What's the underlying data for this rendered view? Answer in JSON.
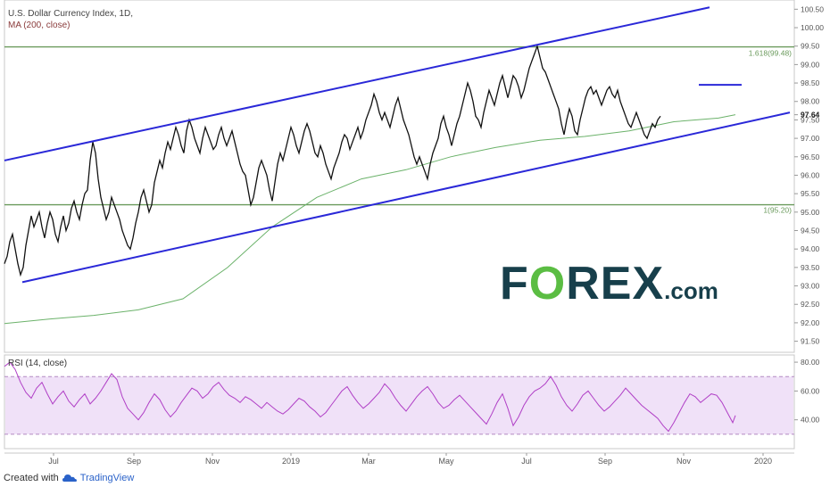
{
  "chart_data": {
    "type": "line",
    "title": "U.S. Dollar Currency Index, 1D,",
    "subtitle": "MA (200, close)",
    "x_ticks": [
      "Jul",
      "Sep",
      "Nov",
      "2019",
      "Mar",
      "May",
      "Jul",
      "Sep",
      "Nov",
      "2020"
    ],
    "y_ticks": [
      "100.50",
      "100.00",
      "99.50",
      "99.00",
      "98.50",
      "98.00",
      "97.64",
      "97.50",
      "97.00",
      "96.50",
      "96.00",
      "95.50",
      "95.00",
      "94.50",
      "94.00",
      "93.50",
      "93.00",
      "92.50",
      "92.00",
      "91.50"
    ],
    "ylim": [
      91.2,
      100.75
    ],
    "price_series": {
      "x": [
        0,
        3,
        6,
        9,
        12,
        15,
        18,
        21,
        24,
        27,
        30,
        33,
        36,
        39,
        42,
        45,
        48,
        51,
        54,
        57,
        60,
        63,
        66,
        69,
        72,
        75,
        78,
        81,
        84,
        87,
        90,
        93,
        96,
        99,
        102,
        105,
        108,
        111,
        114,
        117,
        120,
        123,
        126,
        129,
        132,
        135,
        138,
        141,
        144,
        147,
        150,
        153,
        156,
        159,
        162,
        165,
        168,
        171,
        174,
        177,
        180,
        183,
        186,
        189,
        192,
        195,
        198,
        201,
        204,
        207,
        210,
        213,
        216,
        219,
        222,
        225,
        228,
        231,
        234,
        237,
        240,
        243,
        246,
        249,
        252,
        255,
        258,
        261,
        264,
        267,
        270,
        273,
        276,
        279,
        282,
        285,
        288,
        291,
        294,
        297,
        300,
        303,
        306,
        309,
        312,
        315,
        318,
        321,
        324,
        327,
        330,
        333,
        336,
        339,
        342,
        345,
        348,
        351,
        354,
        357,
        360,
        363,
        366,
        369,
        372,
        375,
        378,
        381,
        384,
        387,
        390,
        393,
        396,
        399,
        402,
        405,
        408,
        411,
        414,
        417,
        420,
        423,
        426,
        429,
        432,
        435,
        438,
        441,
        444,
        447,
        450,
        453,
        456,
        459,
        462,
        465,
        468,
        471,
        474,
        477,
        480,
        483,
        486,
        489,
        492,
        495,
        498,
        501,
        504,
        507,
        510,
        513,
        516,
        519,
        522,
        525,
        528,
        531,
        534,
        537,
        540,
        543,
        546,
        549,
        552,
        555,
        558,
        561,
        564,
        567,
        570,
        573,
        576,
        579,
        582,
        585,
        588,
        591,
        594,
        597,
        600,
        603,
        606,
        609,
        612,
        615,
        618,
        621,
        624,
        627,
        630,
        633,
        636,
        639,
        642,
        645,
        648,
        651,
        654,
        657,
        660,
        663,
        666,
        669,
        672,
        675,
        678,
        681,
        684,
        687,
        690,
        693,
        696,
        699,
        702,
        705,
        708,
        711,
        714,
        717,
        720,
        723,
        726,
        729,
        732,
        735,
        738,
        741,
        744,
        747,
        750,
        753,
        756,
        759,
        762,
        765,
        768,
        771,
        774,
        777,
        780,
        783,
        786,
        789,
        792,
        795,
        798,
        801,
        804,
        807,
        810,
        813,
        816,
        819
      ],
      "close": [
        93.6,
        93.8,
        94.2,
        94.4,
        94.0,
        93.6,
        93.3,
        93.5,
        94.1,
        94.5,
        94.9,
        94.6,
        94.8,
        95.0,
        94.6,
        94.3,
        94.7,
        95.0,
        94.8,
        94.4,
        94.2,
        94.6,
        94.9,
        94.5,
        94.7,
        95.1,
        95.3,
        95.0,
        94.8,
        95.2,
        95.5,
        95.6,
        96.4,
        96.9,
        96.6,
        95.9,
        95.4,
        95.1,
        94.8,
        95.0,
        95.4,
        95.2,
        95.0,
        94.8,
        94.5,
        94.3,
        94.1,
        94.0,
        94.3,
        94.7,
        95.0,
        95.4,
        95.6,
        95.3,
        95.0,
        95.2,
        95.8,
        96.1,
        96.4,
        96.2,
        96.6,
        96.9,
        96.7,
        97.0,
        97.3,
        97.1,
        96.8,
        96.6,
        97.2,
        97.5,
        97.3,
        97.0,
        96.8,
        96.6,
        97.0,
        97.3,
        97.1,
        96.9,
        96.7,
        96.8,
        97.1,
        97.3,
        97.0,
        96.8,
        97.0,
        97.2,
        96.9,
        96.6,
        96.3,
        96.1,
        96.0,
        95.6,
        95.2,
        95.4,
        95.8,
        96.2,
        96.4,
        96.2,
        96.0,
        95.6,
        95.3,
        95.8,
        96.3,
        96.6,
        96.4,
        96.7,
        97.0,
        97.3,
        97.1,
        96.8,
        96.6,
        96.9,
        97.2,
        97.4,
        97.2,
        96.9,
        96.6,
        96.5,
        96.8,
        96.6,
        96.3,
        96.1,
        95.9,
        96.2,
        96.4,
        96.6,
        96.9,
        97.1,
        97.0,
        96.7,
        96.9,
        97.1,
        97.3,
        97.0,
        97.2,
        97.5,
        97.7,
        97.9,
        98.2,
        98.0,
        97.7,
        97.5,
        97.7,
        97.5,
        97.3,
        97.6,
        97.9,
        98.1,
        97.8,
        97.5,
        97.3,
        97.1,
        96.8,
        96.5,
        96.3,
        96.5,
        96.3,
        96.1,
        95.9,
        96.3,
        96.6,
        96.8,
        97.0,
        97.4,
        97.6,
        97.3,
        97.1,
        96.8,
        97.1,
        97.4,
        97.6,
        97.9,
        98.2,
        98.5,
        98.3,
        98.0,
        97.6,
        97.5,
        97.3,
        97.7,
        98.0,
        98.3,
        98.1,
        97.9,
        98.2,
        98.5,
        98.7,
        98.4,
        98.1,
        98.4,
        98.7,
        98.6,
        98.4,
        98.1,
        98.3,
        98.6,
        98.9,
        99.1,
        99.3,
        99.5,
        99.2,
        98.9,
        98.8,
        98.6,
        98.4,
        98.2,
        98.0,
        97.8,
        97.4,
        97.1,
        97.5,
        97.8,
        97.6,
        97.2,
        97.1,
        97.5,
        97.8,
        98.1,
        98.3,
        98.4,
        98.2,
        98.3,
        98.1,
        97.9,
        98.1,
        98.3,
        98.4,
        98.2,
        98.1,
        98.3,
        98.0,
        97.8,
        97.6,
        97.4,
        97.3,
        97.5,
        97.7,
        97.5,
        97.3,
        97.1,
        97.0,
        97.2,
        97.4,
        97.3,
        97.5,
        97.6
      ]
    },
    "ma_series": {
      "name": "MA (200, close)",
      "x": [
        0,
        50,
        100,
        150,
        200,
        250,
        300,
        350,
        400,
        450,
        500,
        550,
        600,
        650,
        700,
        750,
        800,
        819
      ],
      "y": [
        91.98,
        92.1,
        92.2,
        92.35,
        92.65,
        93.5,
        94.6,
        95.4,
        95.9,
        96.15,
        96.5,
        96.75,
        96.95,
        97.05,
        97.2,
        97.45,
        97.55,
        97.64
      ]
    },
    "fib_levels": [
      {
        "label": "1.618(99.48)",
        "value": 99.48
      },
      {
        "label": "1(95.20)",
        "value": 95.2
      }
    ],
    "current_price_label": "97.64",
    "trendlines": [
      {
        "from": [
          0,
          96.4
        ],
        "to": [
          790,
          100.55
        ]
      },
      {
        "from": [
          20,
          93.1
        ],
        "to": [
          880,
          97.7
        ]
      },
      {
        "from": [
          778,
          98.45
        ],
        "to": [
          826,
          98.45
        ]
      }
    ],
    "rsi": {
      "label": "RSI (14, close)",
      "y_ticks": [
        "80.00",
        "60.00",
        "40.00"
      ],
      "ylim": [
        20,
        85
      ],
      "band": [
        30,
        70
      ],
      "x": [
        0,
        6,
        12,
        18,
        24,
        30,
        36,
        42,
        48,
        54,
        60,
        66,
        72,
        78,
        84,
        90,
        96,
        102,
        108,
        114,
        120,
        126,
        132,
        138,
        144,
        150,
        156,
        162,
        168,
        174,
        180,
        186,
        192,
        198,
        204,
        210,
        216,
        222,
        228,
        234,
        240,
        246,
        252,
        258,
        264,
        270,
        276,
        282,
        288,
        294,
        300,
        306,
        312,
        318,
        324,
        330,
        336,
        342,
        348,
        354,
        360,
        366,
        372,
        378,
        384,
        390,
        396,
        402,
        408,
        414,
        420,
        426,
        432,
        438,
        444,
        450,
        456,
        462,
        468,
        474,
        480,
        486,
        492,
        498,
        504,
        510,
        516,
        522,
        528,
        534,
        540,
        546,
        552,
        558,
        564,
        570,
        576,
        582,
        588,
        594,
        600,
        606,
        612,
        618,
        624,
        630,
        636,
        642,
        648,
        654,
        660,
        666,
        672,
        678,
        684,
        690,
        696,
        702,
        708,
        714,
        720,
        726,
        732,
        738,
        744,
        750,
        756,
        762,
        768,
        774,
        780,
        786,
        792,
        798,
        804,
        810,
        816,
        819
      ],
      "values": [
        77,
        80,
        75,
        66,
        59,
        55,
        62,
        66,
        58,
        51,
        56,
        60,
        53,
        49,
        54,
        58,
        51,
        55,
        60,
        66,
        72,
        68,
        56,
        48,
        44,
        40,
        45,
        52,
        58,
        54,
        47,
        42,
        46,
        52,
        57,
        62,
        60,
        55,
        58,
        63,
        66,
        61,
        57,
        55,
        52,
        56,
        54,
        51,
        48,
        52,
        49,
        46,
        44,
        47,
        51,
        55,
        53,
        49,
        46,
        42,
        45,
        50,
        55,
        60,
        63,
        57,
        52,
        48,
        51,
        55,
        59,
        65,
        61,
        55,
        50,
        46,
        51,
        56,
        60,
        63,
        58,
        52,
        48,
        50,
        54,
        57,
        53,
        49,
        45,
        41,
        37,
        44,
        52,
        58,
        48,
        36,
        42,
        50,
        56,
        60,
        62,
        65,
        70,
        64,
        56,
        50,
        46,
        51,
        57,
        60,
        55,
        50,
        46,
        49,
        53,
        57,
        62,
        58,
        54,
        50,
        47,
        44,
        41,
        36,
        32,
        38,
        45,
        52,
        58,
        56,
        52,
        55,
        58,
        57,
        52,
        45,
        38,
        43
      ]
    },
    "watermark": "FOREX.com",
    "footer": {
      "prefix": "Created with",
      "brand": "TradingView"
    }
  }
}
